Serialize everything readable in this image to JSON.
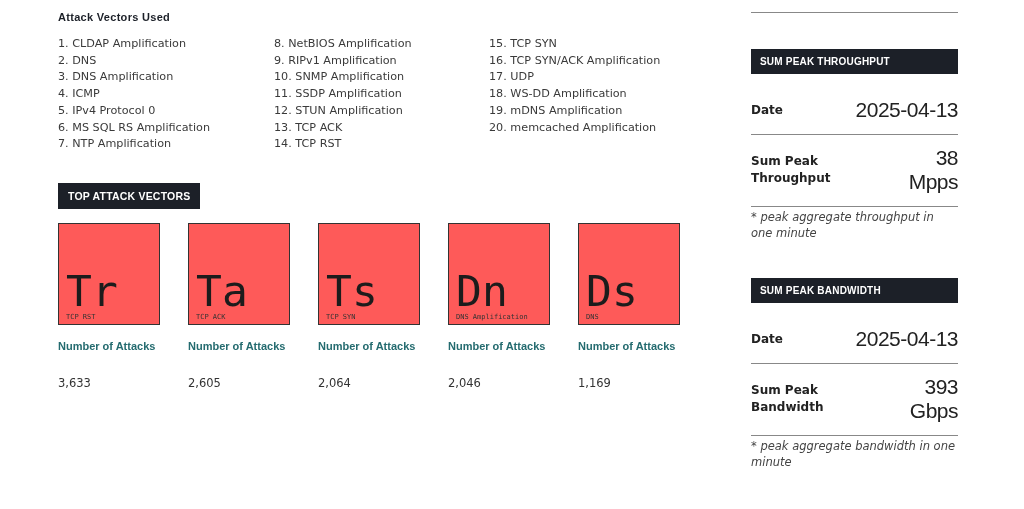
{
  "vectors_used": {
    "title": "Attack Vectors Used",
    "columns": [
      [
        "1. CLDAP Amplification",
        "2. DNS",
        "3. DNS Amplification",
        "4. ICMP",
        "5. IPv4 Protocol 0",
        "6. MS SQL RS Amplification",
        "7. NTP Amplification"
      ],
      [
        "8. NetBIOS Amplification",
        "9. RIPv1 Amplification",
        "10. SNMP Amplification",
        "11. SSDP Amplification",
        "12. STUN Amplification",
        "13. TCP ACK",
        "14. TCP RST"
      ],
      [
        "15. TCP SYN",
        "16. TCP SYN/ACK Amplification",
        "17. UDP",
        "18. WS-DD Amplification",
        "19. mDNS Amplification",
        "20. memcached Amplification"
      ]
    ]
  },
  "top_vectors": {
    "title": "TOP ATTACK VECTORS",
    "items": [
      {
        "symbol": "Tr",
        "name": "TCP RST",
        "label": "Number of Attacks",
        "value": "3,633"
      },
      {
        "symbol": "Ta",
        "name": "TCP ACK",
        "label": "Number of Attacks",
        "value": "2,605"
      },
      {
        "symbol": "Ts",
        "name": "TCP SYN",
        "label": "Number of Attacks",
        "value": "2,064"
      },
      {
        "symbol": "Dn",
        "name": "DNS Amplification",
        "label": "Number of Attacks",
        "value": "2,046"
      },
      {
        "symbol": "Ds",
        "name": "DNS",
        "label": "Number of Attacks",
        "value": "1,169"
      }
    ]
  },
  "panels": [
    {
      "title": "SUM PEAK THROUGHPUT",
      "rows": [
        {
          "label": "Date",
          "value": "2025-04-13"
        },
        {
          "label": "Sum Peak Throughput",
          "value": "38",
          "unit": "Mpps"
        }
      ],
      "note": "* peak aggregate throughput in one minute"
    },
    {
      "title": "SUM PEAK BANDWIDTH",
      "rows": [
        {
          "label": "Date",
          "value": "2025-04-13"
        },
        {
          "label": "Sum Peak Bandwidth",
          "value": "393",
          "unit": "Gbps"
        }
      ],
      "note": "* peak aggregate bandwidth in one minute"
    }
  ]
}
